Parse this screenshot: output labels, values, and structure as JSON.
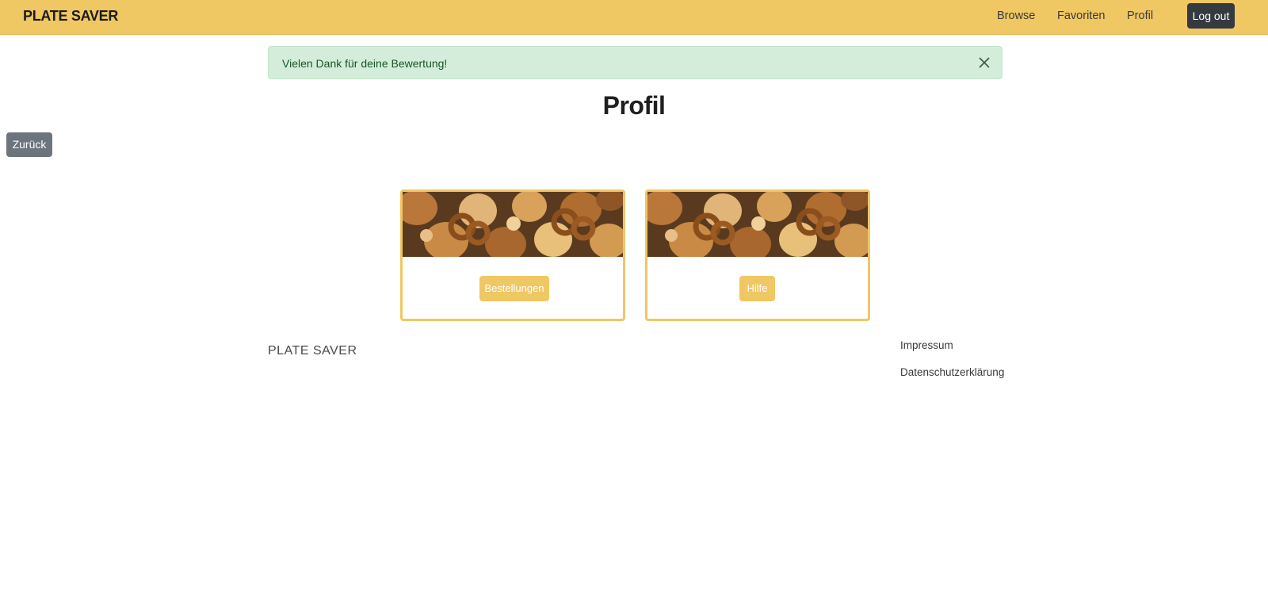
{
  "navbar": {
    "brand": "PLATE SAVER",
    "links": {
      "browse": "Browse",
      "favoriten": "Favoriten",
      "profil": "Profil"
    },
    "logout_label": "Log out",
    "background_color": "#efc763"
  },
  "alert": {
    "message": "Vielen Dank für deine Bewertung!",
    "close_icon": "close-icon"
  },
  "page": {
    "title": "Profil",
    "back_label": "Zurück"
  },
  "cards": [
    {
      "image": "baked-goods-photo",
      "button_label": "Bestellungen"
    },
    {
      "image": "baked-goods-photo",
      "button_label": "Hilfe"
    }
  ],
  "footer": {
    "brand": "PLATE SAVER",
    "impressum": "Impressum",
    "datenschutz": "Datenschutzerklärung"
  },
  "colors": {
    "accent": "#efc763",
    "alert_bg": "#d4edda",
    "alert_text": "#155724",
    "logout_bg": "#343a40",
    "back_bg": "#6c757d"
  }
}
